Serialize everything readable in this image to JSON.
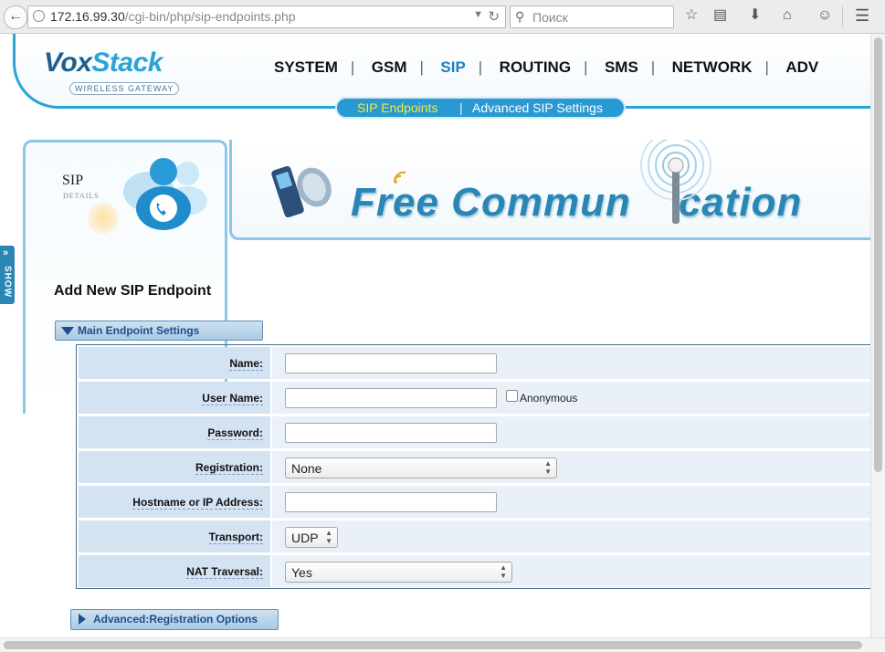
{
  "browser": {
    "url_host": "172.16.99.30",
    "url_path": "/cgi-bin/php/sip-endpoints.php",
    "search_placeholder": "Поиск"
  },
  "logo": {
    "part1": "Vox",
    "part2": "Stack",
    "subtitle": "WIRELESS GATEWAY"
  },
  "nav": {
    "items": [
      "SYSTEM",
      "GSM",
      "SIP",
      "ROUTING",
      "SMS",
      "NETWORK",
      "ADV"
    ],
    "active": "SIP",
    "separator": "|"
  },
  "subnav": {
    "active_label": "SIP Endpoints",
    "separator": "|",
    "link_label": "Advanced SIP Settings"
  },
  "sidebar": {
    "title": "SIP",
    "subtitle": "DETAILS",
    "show_label": "SHOW",
    "show_arrows": "»"
  },
  "banner": {
    "text_part1": "Free Commun",
    "text_part2": "cation"
  },
  "form": {
    "title": "Add New SIP Endpoint",
    "main_section_label": "Main Endpoint Settings",
    "advanced_section_label": "Advanced:Registration Options",
    "fields": {
      "name_label": "Name:",
      "name_value": "",
      "username_label": "User Name:",
      "username_value": "",
      "anonymous_label": "Anonymous",
      "anonymous_checked": false,
      "password_label": "Password:",
      "password_value": "",
      "registration_label": "Registration:",
      "registration_value": "None",
      "hostname_label": "Hostname or IP Address:",
      "hostname_value": "",
      "transport_label": "Transport:",
      "transport_value": "UDP",
      "nat_label": "NAT Traversal:",
      "nat_value": "Yes"
    }
  },
  "colors": {
    "accent": "#2aa3d6",
    "nav_active": "#1a7fc0",
    "subnav_active": "#f5e83a",
    "label_bg": "#d4e3f2"
  }
}
